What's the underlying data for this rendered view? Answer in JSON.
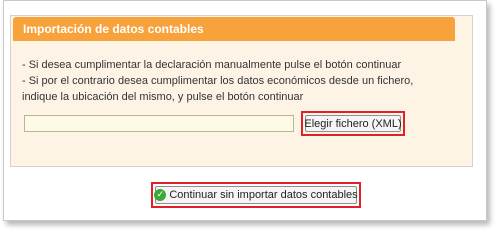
{
  "panel": {
    "title": "Importación de datos contables",
    "instruction_line1": "- Si desea cumplimentar la declaración manualmente pulse el botón continuar",
    "instruction_line2": "- Si por el contrario desea cumplimentar los datos económicos desde un fichero,",
    "instruction_line3": "indique la ubicación del mismo, y pulse el botón continuar",
    "file_input_value": "",
    "choose_file_label": "Elegir fichero (XML)"
  },
  "actions": {
    "continue_label": "Continuar sin importar datos contables",
    "continue_icon": "check-circle-icon"
  },
  "colors": {
    "header_bg": "#f7a23a",
    "panel_bg": "#fdf4e6",
    "highlight": "#e0202a",
    "check_green": "#3aa83a"
  }
}
